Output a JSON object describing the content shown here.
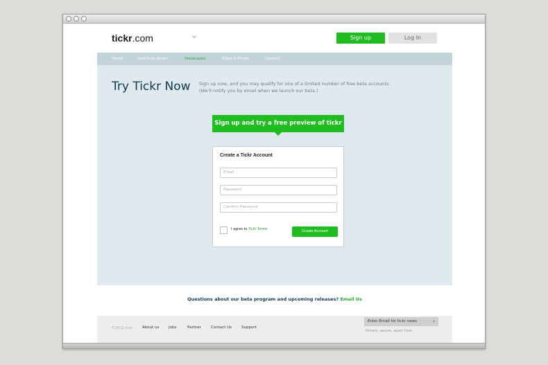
{
  "header": {
    "logo_bold": "tickr",
    "logo_rest": ".com",
    "signup_label": "Sign up",
    "login_label": "Log In"
  },
  "nav": {
    "items": [
      "Home",
      "How tickr works",
      "Showcases",
      "Plans & Prices",
      "Contact"
    ],
    "active": "Showcases"
  },
  "hero": {
    "title": "Try Tickr Now",
    "desc_line1": "Sign up now, and you may qualify for one of a limited number of free beta accounts.",
    "desc_line2": "(We'll notify you by email when we launch our beta.)",
    "cta_label": "Sign up and try a free preview of tickr"
  },
  "form": {
    "title": "Create a Tickr Account",
    "email_placeholder": "Email",
    "password_placeholder": "Password",
    "confirm_placeholder": "Confirm Password",
    "agree_text": "I agree to ",
    "terms_link": "Tickr Terms",
    "create_label": "Create Account"
  },
  "questions": {
    "text": "Questions about our beta program and upcoming releases?",
    "link": "Email Us"
  },
  "footer": {
    "copyright": "©2012 tickr",
    "links": [
      "About us",
      "Jobs",
      "Partner",
      "Contact Us",
      "Support"
    ],
    "newsletter_label": "Enter Email for tickr news",
    "newsletter_note": "Private, secure, spam free!"
  },
  "colors": {
    "accent_green": "#1fbd1f",
    "nav_bg": "#c2d3da",
    "hero_bg": "#dfe9ee",
    "title_navy": "#0f3a52"
  }
}
